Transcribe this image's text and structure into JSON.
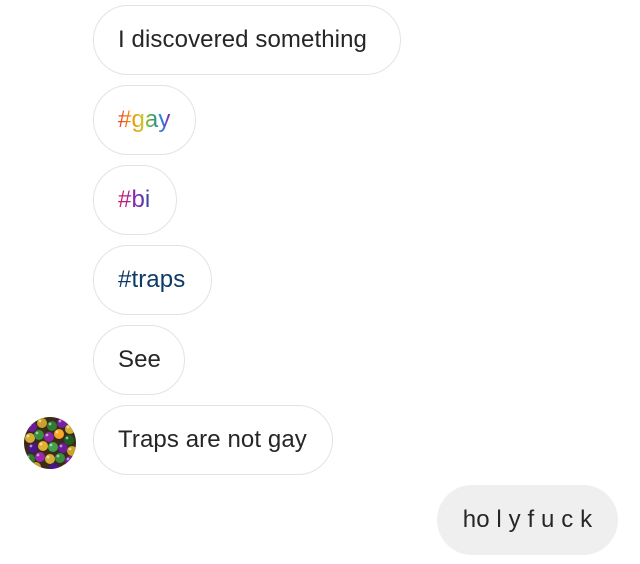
{
  "messages": [
    {
      "id": "m1",
      "text": "I discovered something",
      "direction": "incoming"
    },
    {
      "id": "m2",
      "text": "#gay",
      "direction": "incoming",
      "style": "rainbow-hashtag"
    },
    {
      "id": "m3",
      "text": "#bi",
      "direction": "incoming",
      "style": "bi-hashtag"
    },
    {
      "id": "m4",
      "text": "#traps",
      "direction": "incoming",
      "style": "blue-hashtag"
    },
    {
      "id": "m5",
      "text": "See",
      "direction": "incoming"
    },
    {
      "id": "m6",
      "text": "Traps are not gay",
      "direction": "incoming"
    },
    {
      "id": "m7",
      "text": "ho l y f u c k",
      "direction": "outgoing"
    }
  ],
  "avatar": {
    "icon": "mardi-gras-beads-avatar"
  },
  "colors": {
    "incoming_bubble_border": "#e3e3e3",
    "outgoing_bubble_bg": "#efefef",
    "text": "#262626",
    "traps_hashtag": "#0d3a66"
  }
}
